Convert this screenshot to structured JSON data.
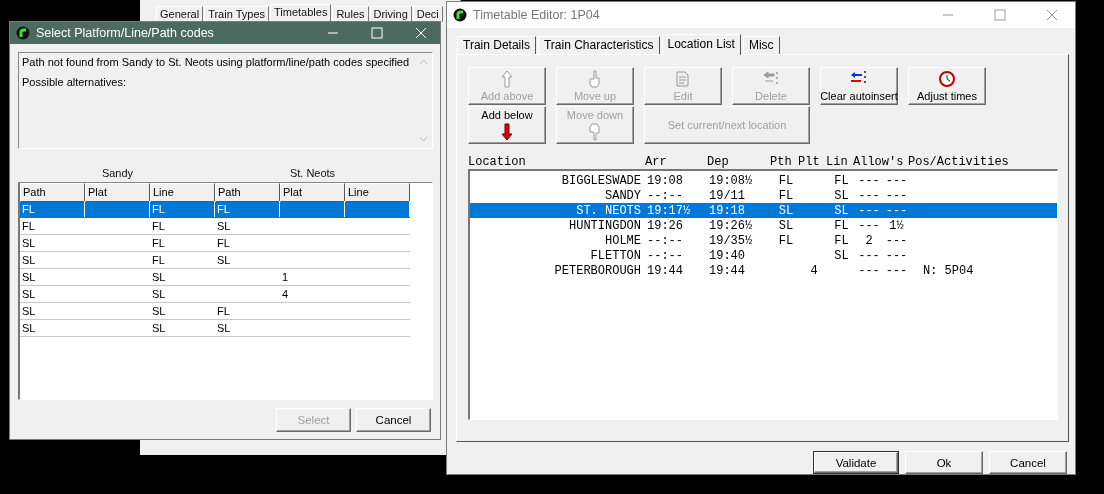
{
  "background_window": {
    "tabs": [
      {
        "label": "General",
        "selected": false
      },
      {
        "label": "Train Types",
        "selected": false
      },
      {
        "label": "Timetables",
        "selected": true
      },
      {
        "label": "Rules",
        "selected": false
      },
      {
        "label": "Driving",
        "selected": false
      },
      {
        "label": "Deci",
        "selected": false
      }
    ]
  },
  "path_dialog": {
    "title": "Select Platform/Line/Path codes",
    "message": [
      "Path not found from Sandy to St. Neots using platform/line/path codes specified",
      "Possible alternatives:"
    ],
    "group_headings": [
      "Sandy",
      "St. Neots"
    ],
    "table": {
      "columns": [
        "Path",
        "Plat",
        "Line",
        "Path",
        "Plat",
        "Line"
      ],
      "rows": [
        {
          "cells": [
            "FL",
            "",
            "FL",
            "FL",
            "",
            ""
          ],
          "selected": true
        },
        {
          "cells": [
            "FL",
            "",
            "FL",
            "SL",
            "",
            ""
          ],
          "selected": false
        },
        {
          "cells": [
            "SL",
            "",
            "FL",
            "FL",
            "",
            ""
          ],
          "selected": false
        },
        {
          "cells": [
            "SL",
            "",
            "FL",
            "SL",
            "",
            ""
          ],
          "selected": false
        },
        {
          "cells": [
            "SL",
            "",
            "SL",
            "",
            "1",
            ""
          ],
          "selected": false
        },
        {
          "cells": [
            "SL",
            "",
            "SL",
            "",
            "4",
            ""
          ],
          "selected": false
        },
        {
          "cells": [
            "SL",
            "",
            "SL",
            "FL",
            "",
            ""
          ],
          "selected": false
        },
        {
          "cells": [
            "SL",
            "",
            "SL",
            "SL",
            "",
            ""
          ],
          "selected": false
        }
      ]
    },
    "buttons": [
      {
        "label": "Select",
        "disabled": true
      },
      {
        "label": "Cancel",
        "disabled": false
      }
    ]
  },
  "editor": {
    "title": "Timetable Editor: 1P04",
    "tabs": [
      {
        "label": "Train Details",
        "selected": false
      },
      {
        "label": "Train Characteristics",
        "selected": false
      },
      {
        "label": "Location List",
        "selected": true
      },
      {
        "label": "Misc",
        "selected": false
      }
    ],
    "toolbar": [
      {
        "label": "Add above",
        "kind": "icon-top",
        "disabled": true
      },
      {
        "label": "Move up",
        "kind": "icon-top",
        "disabled": true
      },
      {
        "label": "Edit",
        "kind": "icon-top",
        "disabled": true
      },
      {
        "label": "Delete",
        "kind": "icon-top",
        "disabled": true
      },
      {
        "label": "Clear autoinsert",
        "kind": "icon-top",
        "disabled": false
      },
      {
        "label": "Adjust times",
        "kind": "icon-top",
        "disabled": false
      },
      {
        "label": "Add below",
        "kind": "icon-bottom",
        "disabled": false
      },
      {
        "label": "Move down",
        "kind": "icon-bottom",
        "disabled": true
      },
      {
        "label": "Set current/next location",
        "kind": "wide",
        "disabled": true
      }
    ],
    "list": {
      "columns": [
        "Location",
        "Arr",
        "Dep",
        "Pth",
        "Plt",
        "Lin",
        "Allow's",
        "Pos/Activities"
      ],
      "rows": [
        {
          "location": "BIGGLESWADE",
          "arr": "19:08",
          "dep": "19:08½",
          "pth": "FL",
          "plt": "",
          "lin": "FL",
          "allow_1": "---",
          "allow_2": "---",
          "activities": "",
          "selected": false
        },
        {
          "location": "SANDY",
          "arr": "--:--",
          "dep": "19/11",
          "pth": "FL",
          "plt": "",
          "lin": "SL",
          "allow_1": "---",
          "allow_2": "---",
          "activities": "",
          "selected": false
        },
        {
          "location": "ST. NEOTS",
          "arr": "19:17½",
          "dep": "19:18",
          "pth": "SL",
          "plt": "",
          "lin": "SL",
          "allow_1": "---",
          "allow_2": "---",
          "activities": "",
          "selected": true
        },
        {
          "location": "HUNTINGDON",
          "arr": "19:26",
          "dep": "19:26½",
          "pth": "SL",
          "plt": "",
          "lin": "FL",
          "allow_1": "---",
          "allow_2": "1½",
          "activities": "",
          "selected": false
        },
        {
          "location": "HOLME",
          "arr": "--:--",
          "dep": "19/35½",
          "pth": "FL",
          "plt": "",
          "lin": "FL",
          "allow_1": "2",
          "allow_2": "---",
          "activities": "",
          "selected": false
        },
        {
          "location": "FLETTON",
          "arr": "--:--",
          "dep": "19:40",
          "pth": "",
          "plt": "",
          "lin": "SL",
          "allow_1": "---",
          "allow_2": "---",
          "activities": "",
          "selected": false
        },
        {
          "location": "PETERBOROUGH",
          "arr": "19:44",
          "dep": "19:44",
          "pth": "",
          "plt": "4",
          "lin": "",
          "allow_1": "---",
          "allow_2": "---",
          "activities": "N: 5P04",
          "selected": false
        }
      ]
    },
    "buttons": [
      {
        "label": "Validate",
        "default": true
      },
      {
        "label": "Ok",
        "default": false
      },
      {
        "label": "Cancel",
        "default": false
      }
    ]
  }
}
